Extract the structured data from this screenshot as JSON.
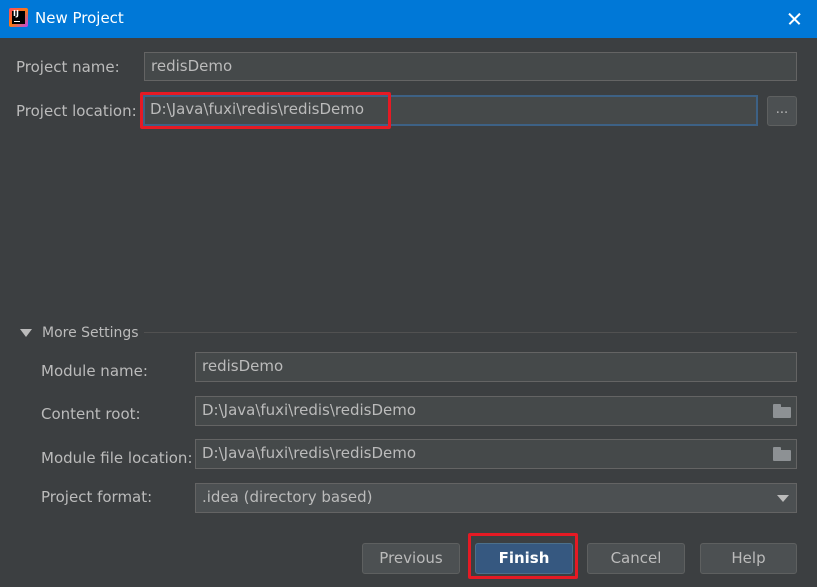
{
  "window": {
    "title": "New Project"
  },
  "project": {
    "name_label": "Project name:",
    "name_value": "redisDemo",
    "location_label": "Project location:",
    "location_value": "D:\\Java\\fuxi\\redis\\redisDemo",
    "browse_label": "..."
  },
  "more_settings": {
    "label": "More Settings",
    "module_name_label": "Module name:",
    "module_name_value": "redisDemo",
    "content_root_label": "Content root:",
    "content_root_value": "D:\\Java\\fuxi\\redis\\redisDemo",
    "module_file_label": "Module file location:",
    "module_file_value": "D:\\Java\\fuxi\\redis\\redisDemo",
    "format_label": "Project format:",
    "format_value": ".idea (directory based)"
  },
  "buttons": {
    "previous": "Previous",
    "finish": "Finish",
    "cancel": "Cancel",
    "help": "Help"
  },
  "colors": {
    "titlebar": "#0078d7",
    "background": "#3c3f41",
    "highlight": "#e51a24",
    "primary_button": "#365880"
  }
}
